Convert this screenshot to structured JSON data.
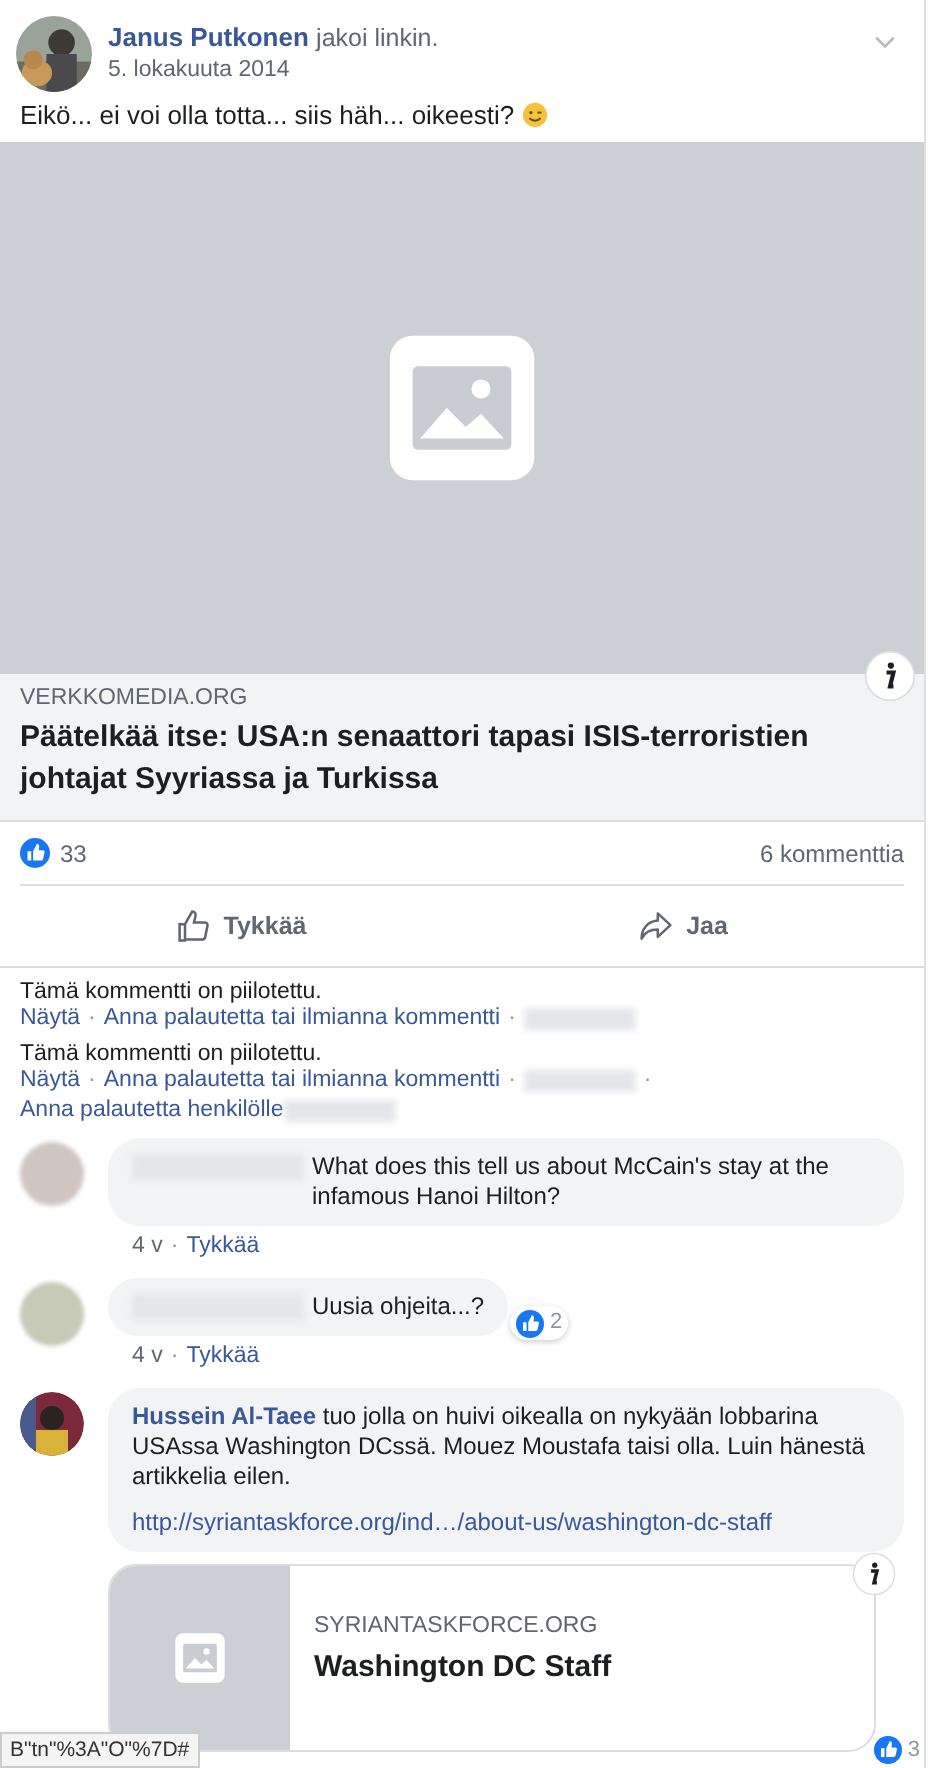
{
  "post": {
    "author": "Janus Putkonen",
    "action": "jakoi linkin.",
    "date": "5. lokakuuta 2014",
    "text": "Eikö... ei voi olla totta... siis häh... oikeesti?"
  },
  "link_preview": {
    "domain": "VERKKOMEDIA.ORG",
    "title": "Päätelkää itse: USA:n senaattori tapasi ISIS-terroristien johtajat Syyriassa ja Turkissa"
  },
  "stats": {
    "likes": "33",
    "comments": "6 kommenttia"
  },
  "actions": [
    {
      "label": "Tykkää",
      "kind": "like"
    },
    {
      "label": "Jaa",
      "kind": "share"
    }
  ],
  "hidden_comments": [
    {
      "text": "Tämä kommentti on piilotettu.",
      "parts": [
        {
          "kind": "link",
          "text": "Näytä"
        },
        {
          "kind": "separator",
          "text": "·"
        },
        {
          "kind": "link",
          "text": "Anna palautetta tai ilmianna kommentti"
        },
        {
          "kind": "separator",
          "text": "·"
        },
        {
          "kind": "redacted"
        }
      ]
    },
    {
      "text": "Tämä kommentti on piilotettu.",
      "parts": [
        {
          "kind": "link",
          "text": "Näytä"
        },
        {
          "kind": "separator",
          "text": "·"
        },
        {
          "kind": "link",
          "text": "Anna palautetta tai ilmianna kommentti"
        },
        {
          "kind": "separator",
          "text": "·"
        },
        {
          "kind": "redacted"
        },
        {
          "kind": "separator",
          "text": "·"
        },
        {
          "kind": "link",
          "text": "Anna palautetta henkilölle"
        },
        {
          "kind": "redacted"
        }
      ]
    }
  ],
  "comments": [
    {
      "avatar": {
        "kind": "blurred"
      },
      "text": "What does this tell us about McCain's stay at the infamous Hanoi Hilton?",
      "time": "4 v",
      "separator": "·",
      "action": "Tykkää"
    },
    {
      "avatar": {
        "kind": "blurred"
      },
      "text": "Uusia ohjeita...?",
      "reactions": "2",
      "time": "4 v",
      "separator": "·",
      "action": "Tykkää"
    },
    {
      "author": "Hussein Al-Taee",
      "text": "tuo jolla on huivi oikealla on nykyään lobbarina USAssa Washington DCssä. Mouez Moustafa taisi olla. Luin hänestä artikkelia eilen.",
      "url": "http://syriantaskforce.org/ind…/about-us/washington-dc-staff",
      "preview": {
        "domain": "SYRIANTASKFORCE.ORG",
        "title": "Washington DC Staff"
      },
      "reactions": "3"
    }
  ],
  "status_text": "B\"tn\"%3A\"O\"%7D#"
}
